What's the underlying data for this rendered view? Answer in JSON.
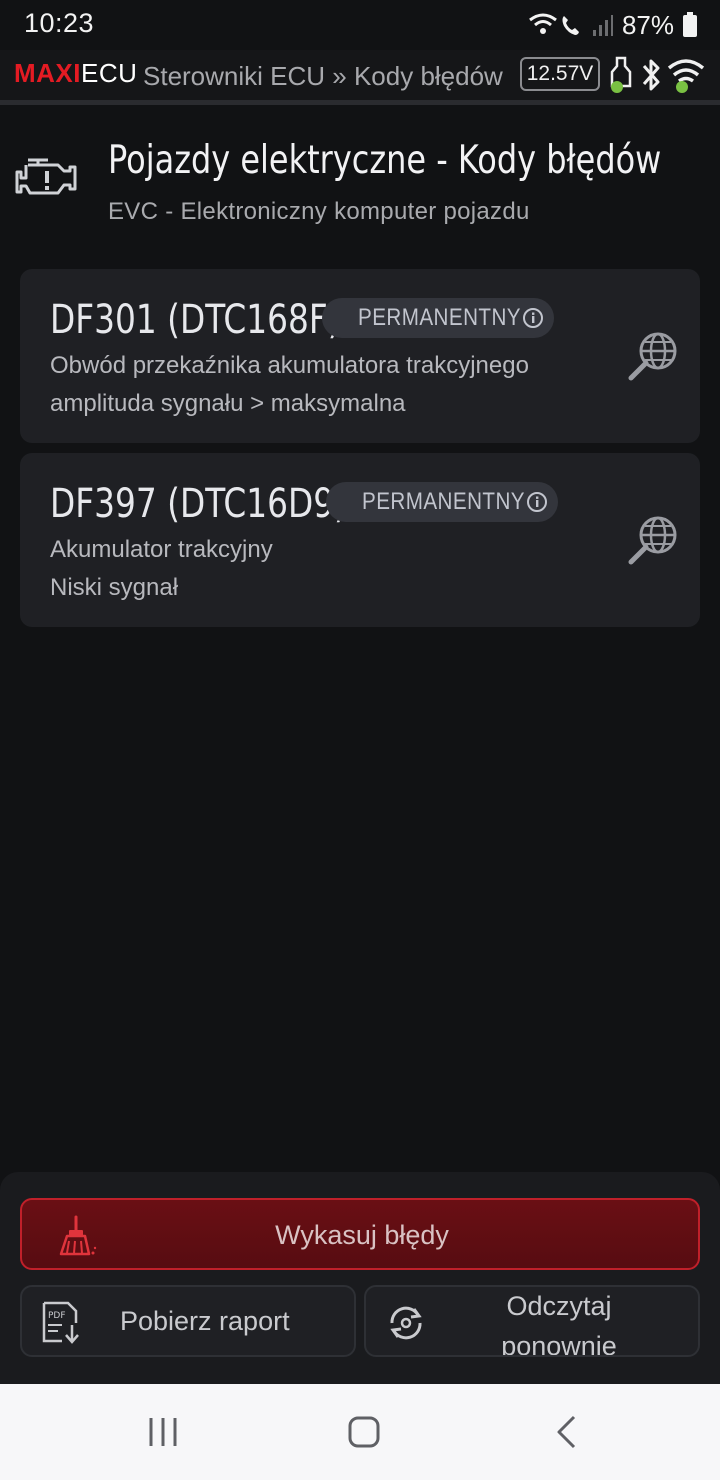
{
  "status_bar": {
    "time": "10:23",
    "battery": "87%"
  },
  "app_bar": {
    "logo_red": "MAXI",
    "logo_white": "ECU",
    "breadcrumb": "Sterowniki ECU » Kody błędów",
    "voltage": "12.57V"
  },
  "header": {
    "title": "Pojazdy elektryczne - Kody błędów",
    "subtitle": "EVC - Elektroniczny komputer pojazdu"
  },
  "dtc_list": [
    {
      "code": "DF301 (DTC168F)",
      "status": "PERMANENTNY",
      "line1": "Obwód przekaźnika akumulatora trakcyjnego",
      "line2": "amplituda sygnału > maksymalna"
    },
    {
      "code": "DF397 (DTC16D9)",
      "status": "PERMANENTNY",
      "line1": "Akumulator trakcyjny",
      "line2": "Niski sygnał"
    }
  ],
  "actions": {
    "clear_label": "Wykasuj błędy",
    "report_label": "Pobierz raport",
    "reread_line1": "Odczytaj",
    "reread_line2": "ponownie"
  },
  "colors": {
    "brand_red": "#e41b23",
    "clear_border": "#c0202a",
    "ok_green": "#7ac143"
  },
  "icons": [
    "wifi-call-icon",
    "signal-icon",
    "battery-icon",
    "engine-check-icon",
    "info-icon",
    "globe-search-icon",
    "broom-icon",
    "pdf-download-icon",
    "refresh-icon",
    "adapter-icon",
    "bluetooth-icon",
    "wifi-icon"
  ]
}
